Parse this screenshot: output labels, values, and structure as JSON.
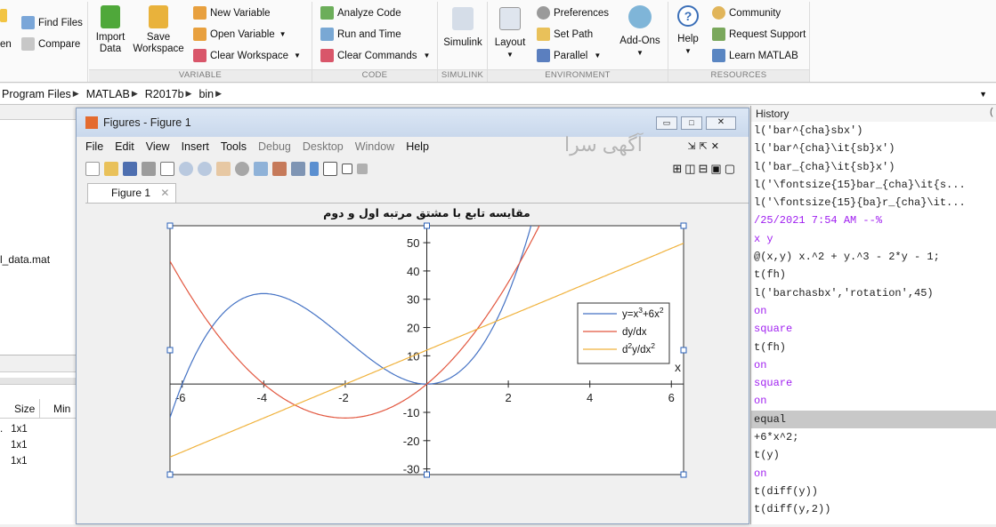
{
  "ribbon": {
    "file": {
      "find_files": "Find Files",
      "compare": "Compare",
      "open_fragment": "en"
    },
    "variable": {
      "import_data": [
        "Import",
        "Data"
      ],
      "save_workspace": [
        "Save",
        "Workspace"
      ],
      "new_variable": "New Variable",
      "open_variable": "Open Variable",
      "clear_workspace": "Clear Workspace",
      "section": "VARIABLE"
    },
    "code": {
      "analyze": "Analyze Code",
      "run_time": "Run and Time",
      "clear_commands": "Clear Commands",
      "section": "CODE"
    },
    "simulink": {
      "label": "Simulink",
      "section": "SIMULINK"
    },
    "environment": {
      "layout": "Layout",
      "preferences": "Preferences",
      "set_path": "Set Path",
      "parallel": "Parallel",
      "addons": "Add-Ons",
      "section": "ENVIRONMENT"
    },
    "resources": {
      "help": "Help",
      "community": "Community",
      "request_support": "Request Support",
      "learn": "Learn MATLAB",
      "section": "RESOURCES"
    }
  },
  "path": {
    "segments": [
      "Program Files",
      "MATLAB",
      "R2017b",
      "bin"
    ]
  },
  "left_panel": {
    "file_item": "l_data.mat",
    "headers": {
      "size": "Size",
      "min": "Min"
    },
    "rows": [
      "1x1",
      "1x1",
      "1x1"
    ]
  },
  "history": {
    "title": "History",
    "lines": [
      {
        "text": "l('bar^{cha}sbx')",
        "kind": "normal"
      },
      {
        "text": "l('bar^{cha}\\it{sb}x')",
        "kind": "normal"
      },
      {
        "text": "l('bar_{cha}\\it{sb}x')",
        "kind": "normal"
      },
      {
        "text": "l('\\fontsize{15}bar_{cha}\\it{s...",
        "kind": "normal"
      },
      {
        "text": "l('\\fontsize{15}{ba}r_{cha}\\it...",
        "kind": "normal"
      },
      {
        "text": "/25/2021 7:54 AM --%",
        "kind": "kw"
      },
      {
        "text": "x y",
        "kind": "kw"
      },
      {
        "text": "@(x,y) x.^2 + y.^3 - 2*y - 1;",
        "kind": "normal"
      },
      {
        "text": "t(fh)",
        "kind": "normal"
      },
      {
        "text": "l('barchasbx','rotation',45)",
        "kind": "normal"
      },
      {
        "text": "on",
        "kind": "kw"
      },
      {
        "text": "square",
        "kind": "kw"
      },
      {
        "text": "t(fh)",
        "kind": "normal"
      },
      {
        "text": "on",
        "kind": "kw"
      },
      {
        "text": "square",
        "kind": "kw"
      },
      {
        "text": "on",
        "kind": "kw"
      },
      {
        "text": "equal",
        "kind": "sel"
      },
      {
        "text": "+6*x^2;",
        "kind": "normal"
      },
      {
        "text": "t(y)",
        "kind": "normal"
      },
      {
        "text": "on",
        "kind": "kw"
      },
      {
        "text": "t(diff(y))",
        "kind": "normal"
      },
      {
        "text": "t(diff(y,2))",
        "kind": "normal"
      }
    ]
  },
  "figure": {
    "window_title": "Figures - Figure 1",
    "menu": [
      "File",
      "Edit",
      "View",
      "Insert",
      "Tools",
      "Debug",
      "Desktop",
      "Window",
      "Help"
    ],
    "tab": "Figure 1",
    "watermark": "آگهی سرا"
  },
  "chart_data": {
    "type": "line",
    "title": "مقایسه تابع با مشتق مرتبه اول و دوم",
    "xlabel": "x",
    "xlim": [
      -6.3,
      6.3
    ],
    "ylim": [
      -32,
      56
    ],
    "xticks": [
      -6,
      -4,
      -2,
      2,
      4,
      6
    ],
    "yticks": [
      -30,
      -20,
      -10,
      10,
      20,
      30,
      40,
      50
    ],
    "legend_position": "right",
    "series": [
      {
        "name": "y=x^3+6x^2",
        "legend_main": "y=x",
        "legend_sup1": "3",
        "legend_mid": "+6x",
        "legend_sup2": "2",
        "color": "#4472c4",
        "expr": "cubic"
      },
      {
        "name": "dy/dx",
        "legend_main": "dy/dx",
        "color": "#e2563e",
        "expr": "first"
      },
      {
        "name": "d^2y/dx^2",
        "legend_main": "d",
        "legend_sup1": "2",
        "legend_mid": "y/dx",
        "legend_sup2": "2",
        "color": "#f0b23c",
        "expr": "second"
      }
    ]
  }
}
